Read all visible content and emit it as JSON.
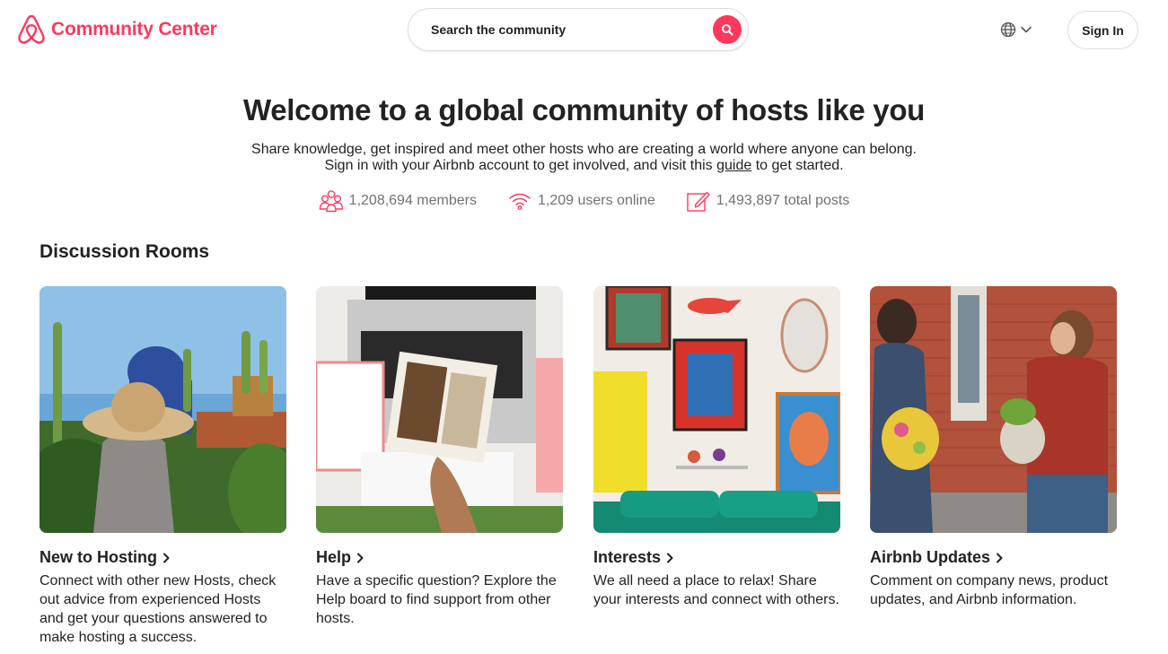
{
  "header": {
    "brand": "Community Center",
    "search_placeholder": "Search the community",
    "signin_label": "Sign In"
  },
  "hero": {
    "title": "Welcome to a global community of hosts like you",
    "line1": "Share knowledge, get inspired and meet other hosts who are creating a world where anyone can belong.",
    "line2_before": "Sign in with your Airbnb account to get involved, and visit this ",
    "line2_link": "guide",
    "line2_after": " to get started."
  },
  "stats": {
    "members": "1,208,694 members",
    "online": "1,209 users online",
    "posts": "1,493,897 total posts"
  },
  "rooms": {
    "title": "Discussion Rooms",
    "cards": [
      {
        "title": "New to Hosting",
        "desc": "Connect with other new Hosts, check out advice from experienced Hosts and get your questions answered to make hosting a success."
      },
      {
        "title": "Help",
        "desc": "Have a specific question? Explore the Help board to find support from other hosts."
      },
      {
        "title": "Interests",
        "desc": "We all need a place to relax! Share your interests and connect with others."
      },
      {
        "title": "Airbnb Updates",
        "desc": "Comment on company news, product updates, and Airbnb information."
      }
    ]
  },
  "colors": {
    "brand": "#ff385c",
    "text": "#222222",
    "muted": "#717171",
    "border": "#dddddd"
  },
  "icons": {
    "logo": "airbnb-belo-icon",
    "search": "search-icon",
    "globe": "globe-icon",
    "chevron": "chevron-down-icon",
    "members": "members-icon",
    "online": "wifi-icon",
    "posts": "edit-icon"
  }
}
